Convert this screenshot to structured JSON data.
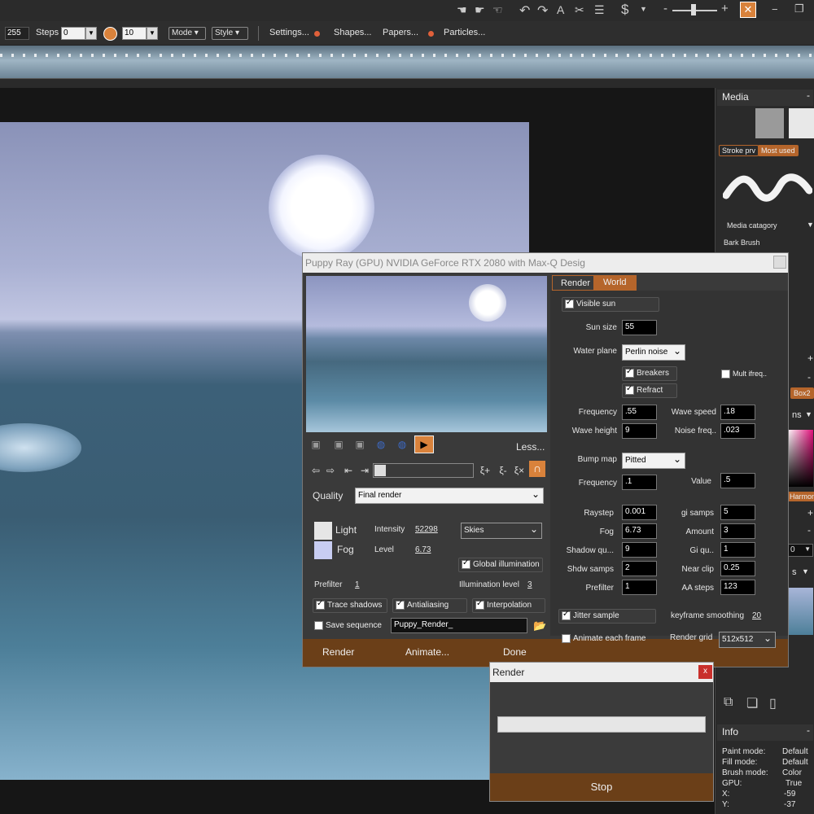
{
  "toolbar": {
    "value_255": "255",
    "steps_label": "Steps",
    "steps_value": "0",
    "size_value": "10",
    "mode_label": "Mode",
    "style_label": "Style",
    "settings_label": "Settings...",
    "shapes_label": "Shapes...",
    "papers_label": "Papers...",
    "particles_label": "Particles..."
  },
  "right_panel": {
    "media_title": "Media",
    "stroke_tab": "Stroke prv",
    "most_used_tab": "Most used",
    "media_category": "Media catagory",
    "brush_name": "Bark Brush",
    "box2": "Box2",
    "ns_partial": "ns",
    "harmony": "Harmony",
    "zero_value": "0",
    "s_partial": "s",
    "info_title": "Info",
    "info": [
      {
        "k": "Paint mode:",
        "v": "Default"
      },
      {
        "k": "Fill mode:",
        "v": "Default"
      },
      {
        "k": "Brush mode:",
        "v": "Color"
      },
      {
        "k": "GPU:",
        "v": "True"
      },
      {
        "k": "X:",
        "v": "-59"
      },
      {
        "k": "Y:",
        "v": "-37"
      }
    ]
  },
  "dialog": {
    "title": "Puppy Ray (GPU)  NVIDIA GeForce RTX 2080 with Max-Q Desig",
    "less_label": "Less...",
    "quality_label": "Quality",
    "quality_value": "Final render",
    "light_label": "Light",
    "fog_label": "Fog",
    "intensity_label": "Intensity",
    "intensity_value": "52298",
    "level_label": "Level",
    "level_value": "6.73",
    "skies_value": "Skies",
    "global_illum_label": "Global illumination",
    "prefilter_label": "Prefilter",
    "prefilter_value": "1",
    "illum_level_label": "Illumination level",
    "illum_level_value": "3",
    "trace_shadows": "Trace shadows",
    "antialiasing": "Antialiasing",
    "interpolation": "Interpolation",
    "save_sequence": "Save sequence",
    "sequence_name": "Puppy_Render_",
    "render_btn": "Render",
    "animate_btn": "Animate...",
    "done_btn": "Done",
    "tab_render": "Render",
    "tab_world": "World",
    "visible_sun": "Visible sun",
    "sun_size_label": "Sun size",
    "sun_size_value": "55",
    "water_plane_label": "Water plane",
    "water_plane_value": "Perlin noise",
    "breakers": "Breakers",
    "refract": "Refract",
    "mult_ifreq": "Mult ifreq..",
    "frequency_label": "Frequency",
    "frequency_value": ".55",
    "wave_speed_label": "Wave speed",
    "wave_speed_value": ".18",
    "wave_height_label": "Wave height",
    "wave_height_value": "9",
    "noise_freq_label": "Noise freq..",
    "noise_freq_value": ".023",
    "bump_map_label": "Bump map",
    "bump_map_value": "Pitted",
    "bump_freq_label": "Frequency",
    "bump_freq_value": ".1",
    "value_label": "Value",
    "value_value": ".5",
    "raystep_label": "Raystep",
    "raystep_value": "0.001",
    "gi_samps_label": "gi samps",
    "gi_samps_value": "5",
    "fog2_label": "Fog",
    "fog2_value": "6.73",
    "amount_label": "Amount",
    "amount_value": "3",
    "shadow_qu_label": "Shadow qu...",
    "shadow_qu_value": "9",
    "gi_qu_label": "Gi qu..",
    "gi_qu_value": "1",
    "shdw_samps_label": "Shdw samps",
    "shdw_samps_value": "2",
    "near_clip_label": "Near clip",
    "near_clip_value": "0.25",
    "prefilter2_label": "Prefilter",
    "prefilter2_value": "1",
    "aa_steps_label": "AA steps",
    "aa_steps_value": "123",
    "jitter_sample": "Jitter sample",
    "keyframe_smoothing_label": "keyframe smoothing",
    "keyframe_smoothing_value": "20",
    "animate_each_frame": "Animate each frame",
    "render_grid_label": "Render grid",
    "render_grid_value": "512x512"
  },
  "render_dialog": {
    "title": "Render",
    "close": "x",
    "stop_btn": "Stop"
  },
  "colors": {
    "accent": "#b5652b",
    "footer": "#6b3f18",
    "light_swatch": "#e6e6e6",
    "fog_swatch": "#c8cdf2"
  }
}
